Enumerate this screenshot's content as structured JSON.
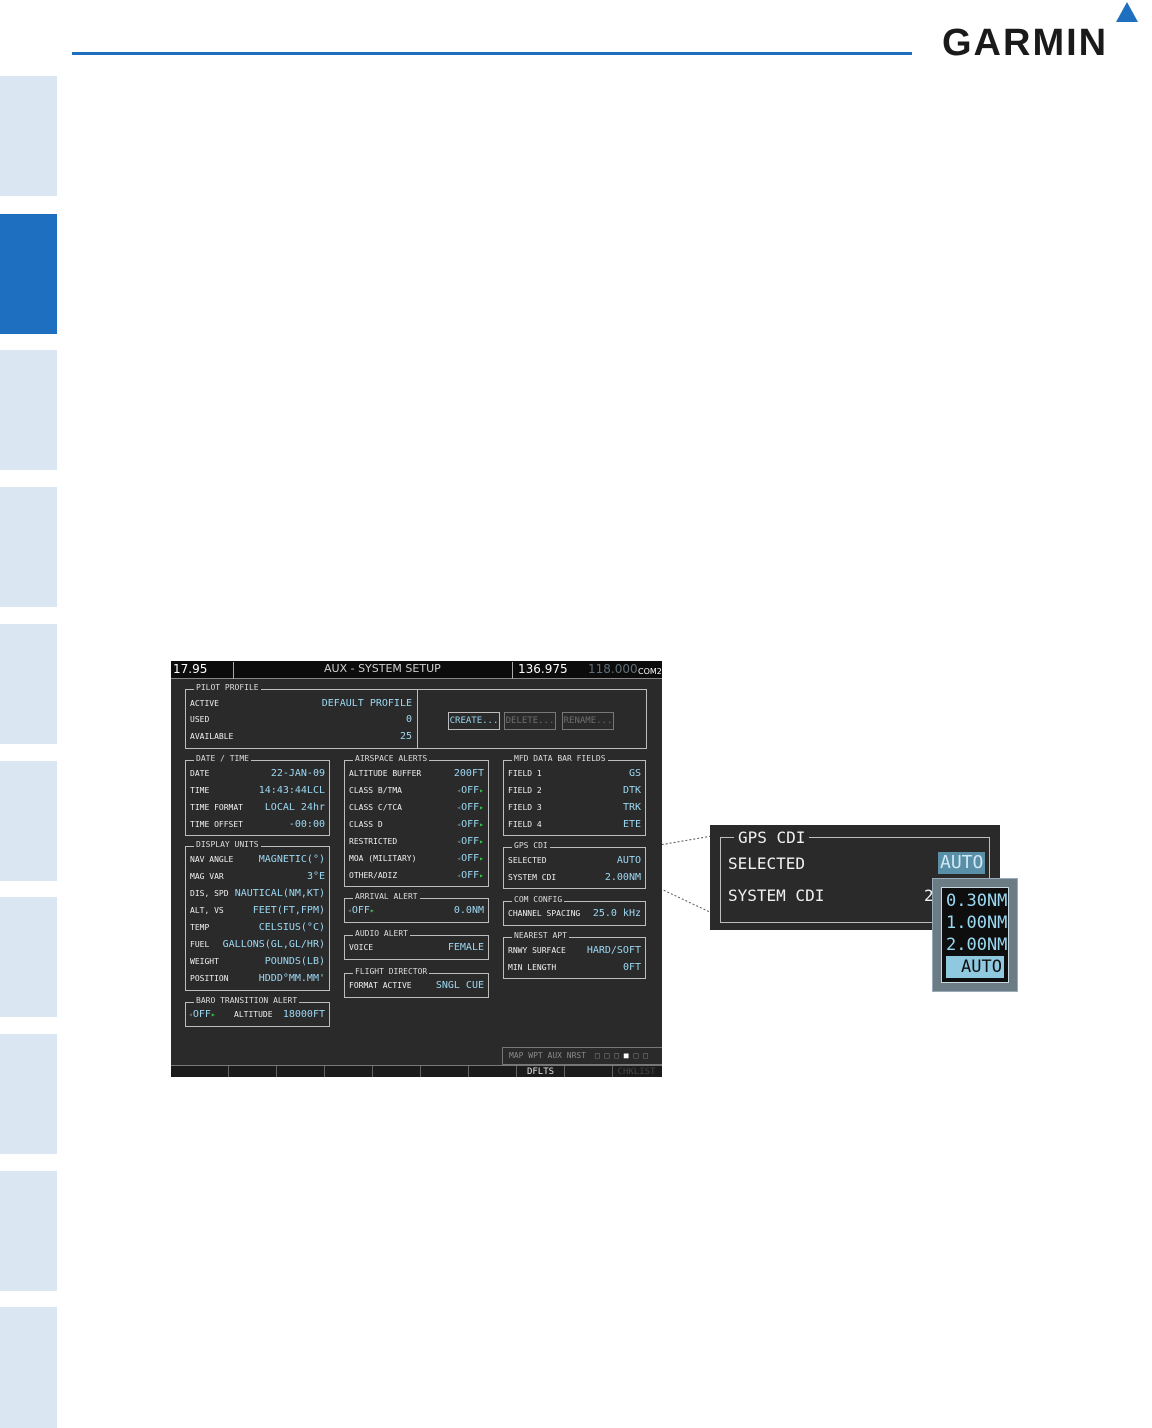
{
  "header": {
    "logo_text": "GARMIN"
  },
  "topbar": {
    "nav_freq": "17.95",
    "page_title": "AUX - SYSTEM SETUP",
    "com_active": "136.975",
    "com_standby": "118.000",
    "com_label": "COM2"
  },
  "pilot_profile": {
    "title": "PILOT PROFILE",
    "rows": [
      {
        "label": "ACTIVE",
        "value": "DEFAULT PROFILE"
      },
      {
        "label": "USED",
        "value": "0"
      },
      {
        "label": "AVAILABLE",
        "value": "25"
      }
    ],
    "buttons": {
      "create": "CREATE...",
      "delete": "DELETE...",
      "rename": "RENAME..."
    }
  },
  "date_time": {
    "title": "DATE / TIME",
    "rows": [
      {
        "label": "DATE",
        "value": "22-JAN-09"
      },
      {
        "label": "TIME",
        "value": "14:43:44LCL"
      },
      {
        "label": "TIME FORMAT",
        "value": "LOCAL 24hr"
      },
      {
        "label": "TIME OFFSET",
        "value": "-00:00"
      }
    ]
  },
  "display_units": {
    "title": "DISPLAY UNITS",
    "rows": [
      {
        "label": "NAV ANGLE",
        "value": "MAGNETIC(°)"
      },
      {
        "label": "MAG VAR",
        "value": "3°E"
      },
      {
        "label": "DIS, SPD",
        "value": "NAUTICAL(NM,KT)"
      },
      {
        "label": "ALT, VS",
        "value": "FEET(FT,FPM)"
      },
      {
        "label": "TEMP",
        "value": "CELSIUS(°C)"
      },
      {
        "label": "FUEL",
        "value": "GALLONS(GL,GL/HR)"
      },
      {
        "label": "WEIGHT",
        "value": "POUNDS(LB)"
      },
      {
        "label": "POSITION",
        "value": "HDDD°MM.MM'"
      }
    ]
  },
  "baro_transition": {
    "title": "BARO TRANSITION ALERT",
    "state": "OFF",
    "label": "ALTITUDE",
    "value": "18000FT"
  },
  "airspace_alerts": {
    "title": "AIRSPACE ALERTS",
    "rows": [
      {
        "label": "ALTITUDE BUFFER",
        "value": "200FT"
      },
      {
        "label": "CLASS B/TMA",
        "value": "OFF"
      },
      {
        "label": "CLASS C/TCA",
        "value": "OFF"
      },
      {
        "label": "CLASS D",
        "value": "OFF"
      },
      {
        "label": "RESTRICTED",
        "value": "OFF"
      },
      {
        "label": "MOA (MILITARY)",
        "value": "OFF"
      },
      {
        "label": "OTHER/ADIZ",
        "value": "OFF"
      }
    ]
  },
  "arrival_alert": {
    "title": "ARRIVAL ALERT",
    "state": "OFF",
    "value": "0.0NM"
  },
  "audio_alert": {
    "title": "AUDIO ALERT",
    "label": "VOICE",
    "value": "FEMALE"
  },
  "flight_director": {
    "title": "FLIGHT DIRECTOR",
    "label": "FORMAT ACTIVE",
    "value": "SNGL CUE"
  },
  "mfd_data_bar": {
    "title": "MFD DATA BAR FIELDS",
    "rows": [
      {
        "label": "FIELD 1",
        "value": "GS"
      },
      {
        "label": "FIELD 2",
        "value": "DTK"
      },
      {
        "label": "FIELD 3",
        "value": "TRK"
      },
      {
        "label": "FIELD 4",
        "value": "ETE"
      }
    ]
  },
  "gps_cdi": {
    "title": "GPS CDI",
    "rows": [
      {
        "label": "SELECTED",
        "value": "AUTO"
      },
      {
        "label": "SYSTEM CDI",
        "value": "2.00NM"
      }
    ]
  },
  "com_config": {
    "title": "COM CONFIG",
    "label": "CHANNEL SPACING",
    "value": "25.0 kHz"
  },
  "nearest_apt": {
    "title": "NEAREST APT",
    "rows": [
      {
        "label": "RNWY SURFACE",
        "value": "HARD/SOFT"
      },
      {
        "label": "MIN LENGTH",
        "value": "0FT"
      }
    ]
  },
  "page_nav": {
    "text": "MAP WPT AUX NRST"
  },
  "softkeys": {
    "dflts": "DFLTS",
    "checklist": "CHKLIST"
  },
  "zoom": {
    "title": "GPS CDI",
    "selected_label": "SELECTED",
    "selected_value": "AUTO",
    "system_label": "SYSTEM CDI",
    "system_value_partial": "2",
    "options": [
      "0.30NM",
      "1.00NM",
      "2.00NM",
      "AUTO"
    ]
  }
}
